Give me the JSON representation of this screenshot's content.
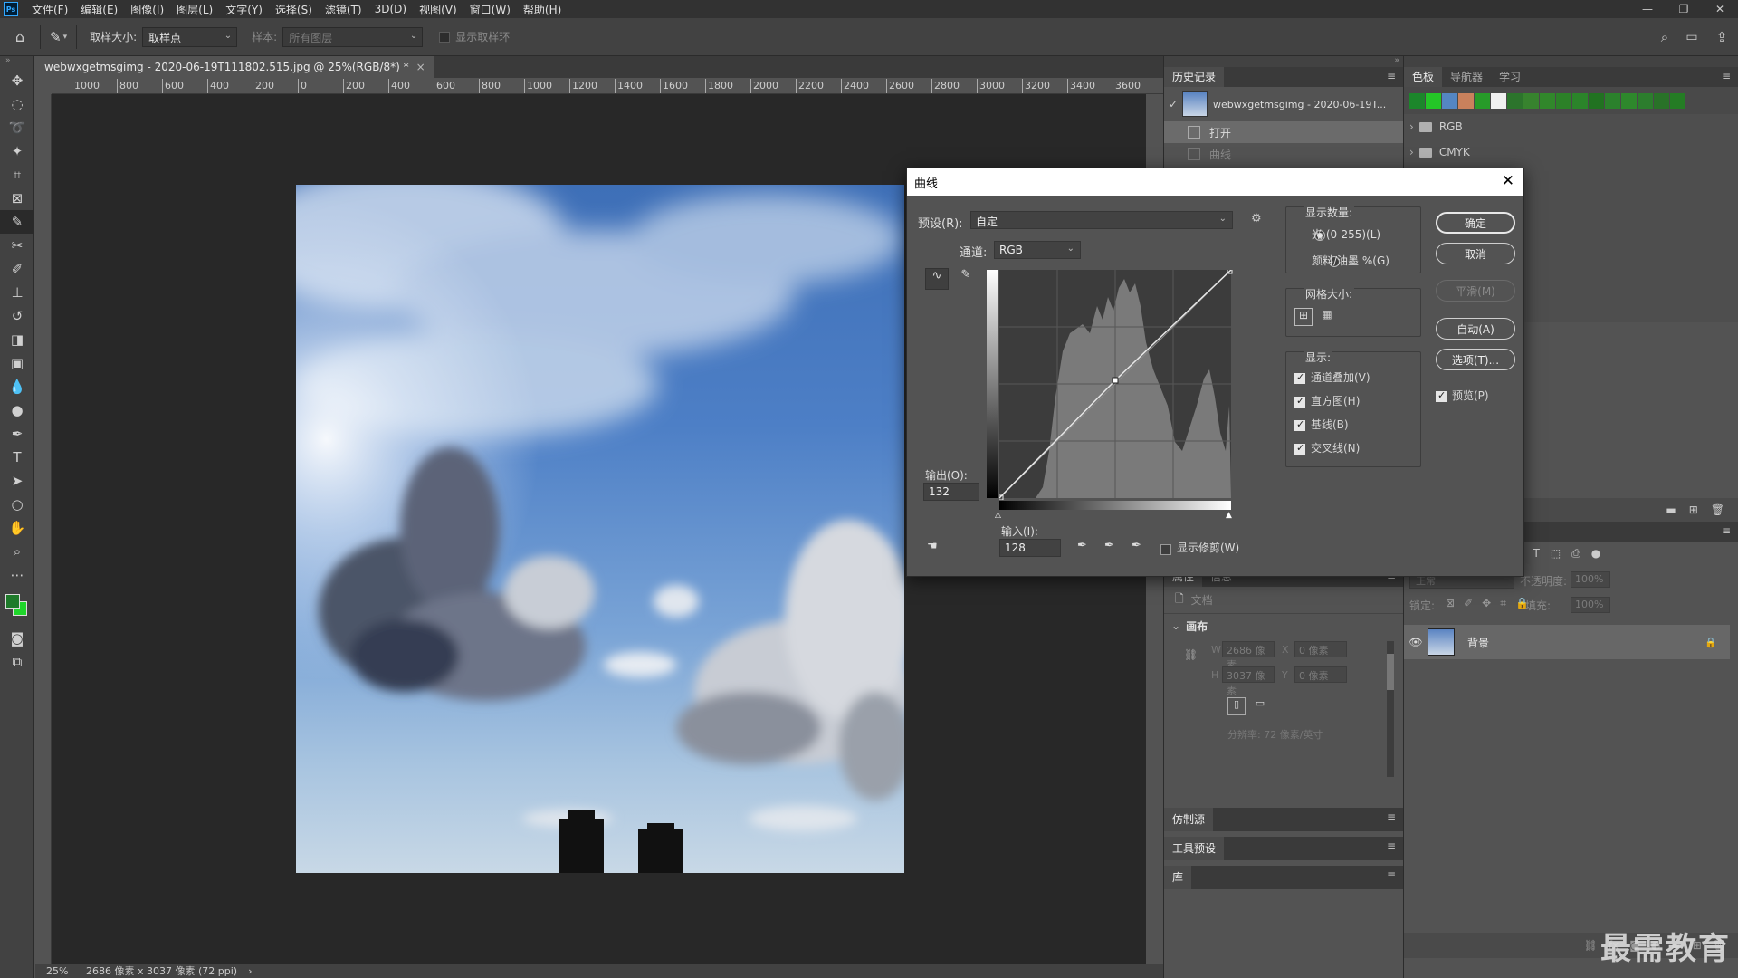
{
  "app": {
    "logo": "Ps"
  },
  "menu": [
    "文件(F)",
    "编辑(E)",
    "图像(I)",
    "图层(L)",
    "文字(Y)",
    "选择(S)",
    "滤镜(T)",
    "3D(D)",
    "视图(V)",
    "窗口(W)",
    "帮助(H)"
  ],
  "window_controls": {
    "minimize": "—",
    "restore": "❐",
    "close": "✕"
  },
  "options": {
    "sample_size_label": "取样大小:",
    "sample_size_value": "取样点",
    "sample_label": "样本:",
    "sample_value": "所有图层",
    "show_ring_label": "显示取样环"
  },
  "document": {
    "tab_title": "webwxgetmsgimg - 2020-06-19T111802.515.jpg @ 25%(RGB/8*) *",
    "tab_close": "×",
    "ruler_ticks": [
      "1000",
      "800",
      "600",
      "400",
      "200",
      "0",
      "200",
      "400",
      "600",
      "800",
      "1000",
      "1200",
      "1400",
      "1600",
      "1800",
      "2000",
      "2200",
      "2400",
      "2600",
      "2800",
      "3000",
      "3200",
      "3400",
      "3600"
    ],
    "zoom": "25%",
    "doc_info": "2686 像素 x 3037 像素 (72 ppi)",
    "status_arrow": "›"
  },
  "history": {
    "tab": "历史记录",
    "snapshot_name": "webwxgetmsgimg - 2020-06-19T...",
    "items": [
      {
        "label": "打开"
      },
      {
        "label": "曲线"
      }
    ]
  },
  "swatches_panel": {
    "tabs": [
      "色板",
      "导航器",
      "学习"
    ],
    "colors": [
      "#1e8f2e",
      "#27d32a",
      "#5a8fd0",
      "#d68a62",
      "#2aa52c",
      "#ffffff",
      "#2f7c2f",
      "#3b8c31",
      "#35902e",
      "#2f8a2b",
      "#2e8d2d",
      "#247a24",
      "#2e8a2f",
      "#31912f",
      "#2f8530",
      "#2c7a2b",
      "#278427"
    ],
    "folders": [
      "RGB",
      "CMYK"
    ]
  },
  "properties": {
    "tabs": [
      "属性",
      "信息"
    ],
    "doc_label": "文档",
    "canvas_section": "画布",
    "w_label": "W",
    "w_value": "2686 像素",
    "h_label": "H",
    "h_value": "3037 像素",
    "x_label": "X",
    "x_value": "0 像素",
    "y_label": "Y",
    "y_value": "0 像素",
    "resolution": "分辨率: 72 像素/英寸"
  },
  "collapsed_panels": [
    "仿制源",
    "工具预设",
    "库"
  ],
  "layers": {
    "blend_mode": "正常",
    "opacity_label": "不透明度:",
    "opacity_value": "100%",
    "lock_label": "锁定:",
    "fill_label": "填充:",
    "fill_value": "100%",
    "layer_name": "背景"
  },
  "curves": {
    "title": "曲线",
    "preset_label": "预设(R):",
    "preset_value": "自定",
    "channel_label": "通道:",
    "channel_value": "RGB",
    "output_label": "输出(O):",
    "output_value": "132",
    "input_label": "输入(I):",
    "input_value": "128",
    "show_clipping": "显示修剪(W)",
    "display_amount_label": "显示数量:",
    "light_option": "光 (0-255)(L)",
    "pigment_option": "颜料/油墨 %(G)",
    "grid_size_label": "网格大小:",
    "show_label": "显示:",
    "show_options": [
      "通道叠加(V)",
      "直方图(H)",
      "基线(B)",
      "交叉线(N)"
    ],
    "buttons": {
      "ok": "确定",
      "cancel": "取消",
      "smooth": "平滑(M)",
      "auto": "自动(A)",
      "options": "选项(T)..."
    },
    "preview_label": "预览(P)"
  },
  "watermark": "最需教育"
}
